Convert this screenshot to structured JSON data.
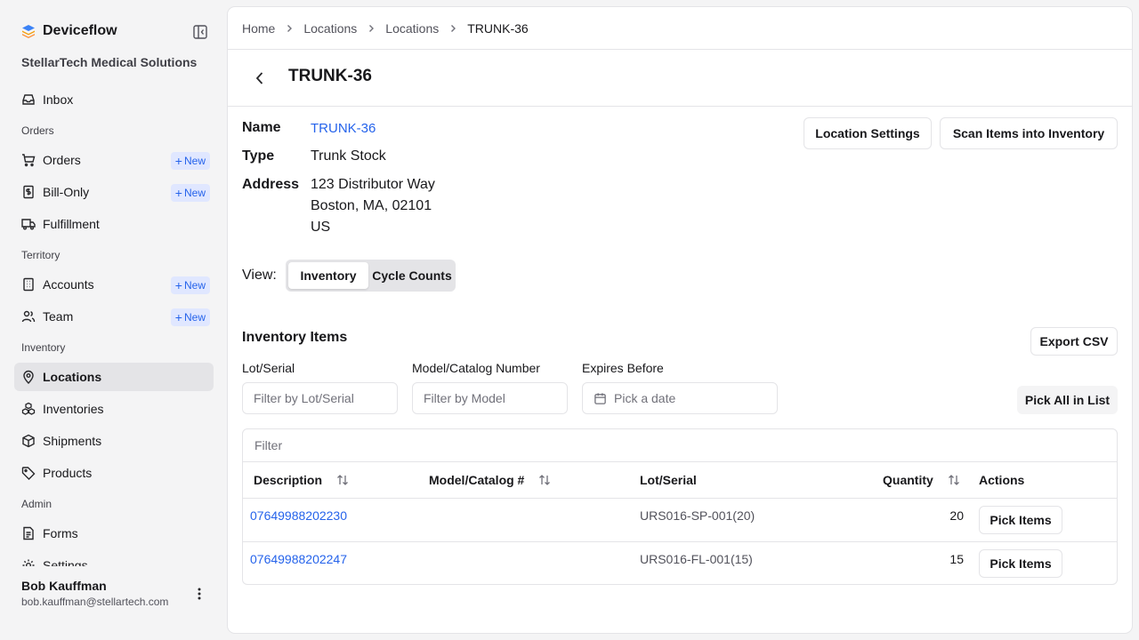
{
  "app": {
    "name": "Deviceflow",
    "org": "StellarTech Medical Solutions"
  },
  "sidebar": {
    "inbox": "Inbox",
    "groups": {
      "orders": "Orders",
      "territory": "Territory",
      "inventory": "Inventory",
      "admin": "Admin"
    },
    "items": {
      "orders": "Orders",
      "bill_only": "Bill-Only",
      "fulfillment": "Fulfillment",
      "accounts": "Accounts",
      "team": "Team",
      "locations": "Locations",
      "inventories": "Inventories",
      "shipments": "Shipments",
      "products": "Products",
      "forms": "Forms",
      "settings": "Settings"
    },
    "new_label": "New",
    "active": "Locations"
  },
  "user": {
    "name": "Bob Kauffman",
    "email": "bob.kauffman@stellartech.com"
  },
  "breadcrumb": [
    "Home",
    "Locations",
    "Locations",
    "TRUNK-36"
  ],
  "page": {
    "title": "TRUNK-36"
  },
  "details": {
    "name_label": "Name",
    "name_value": "TRUNK-36",
    "type_label": "Type",
    "type_value": "Trunk Stock",
    "address_label": "Address",
    "address_line1": "123 Distributor Way",
    "address_line2": "Boston, MA, 02101",
    "address_line3": "US"
  },
  "actions": {
    "location_settings": "Location Settings",
    "scan_items": "Scan Items into Inventory"
  },
  "view": {
    "label": "View:",
    "options": [
      "Inventory",
      "Cycle Counts"
    ],
    "selected": "Inventory"
  },
  "inventory": {
    "title": "Inventory Items",
    "export": "Export CSV",
    "filters": {
      "lot_label": "Lot/Serial",
      "lot_placeholder": "Filter by Lot/Serial",
      "model_label": "Model/Catalog Number",
      "model_placeholder": "Filter by Model",
      "expires_label": "Expires Before",
      "expires_placeholder": "Pick a date"
    },
    "pick_all": "Pick All in List",
    "table_filter_placeholder": "Filter",
    "columns": {
      "description": "Description",
      "model": "Model/Catalog #",
      "lot": "Lot/Serial",
      "quantity": "Quantity",
      "actions": "Actions"
    },
    "rows": [
      {
        "description": "07649988202230",
        "model": "",
        "lot": "URS016-SP-001(20)",
        "quantity": "20",
        "action": "Pick Items"
      },
      {
        "description": "07649988202247",
        "model": "",
        "lot": "URS016-FL-001(15)",
        "quantity": "15",
        "action": "Pick Items"
      }
    ]
  },
  "colors": {
    "accent": "#2563eb",
    "badge_bg": "#e0e7ff",
    "active_bg": "#e4e4e7"
  },
  "icons": {
    "brand": "deviceflow-logo-icon",
    "collapse": "sidebar-collapse-icon",
    "inbox": "inbox-icon",
    "orders": "cart-icon",
    "bill_only": "receipt-dollar-icon",
    "fulfillment": "truck-icon",
    "accounts": "building-icon",
    "team": "users-icon",
    "locations": "map-pin-icon",
    "inventories": "boxes-icon",
    "shipments": "package-icon",
    "products": "tag-icon",
    "forms": "file-text-icon",
    "settings": "gear-icon",
    "user_menu": "more-vertical-icon",
    "back": "chevron-left-icon",
    "calendar": "calendar-icon",
    "sort": "arrow-up-down-icon"
  }
}
